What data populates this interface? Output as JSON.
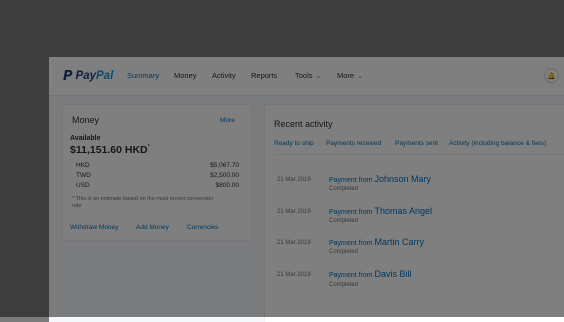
{
  "brand": {
    "logo_glyph": "P",
    "name_part1": "Pay",
    "name_part2": "Pal"
  },
  "nav": {
    "items": [
      {
        "label": "Summary",
        "active": true
      },
      {
        "label": "Money"
      },
      {
        "label": "Activity"
      },
      {
        "label": "Reports"
      },
      {
        "label": "Tools"
      },
      {
        "label": "More"
      }
    ],
    "chevron": "⌄",
    "bell_glyph": "🔔"
  },
  "money": {
    "title": "Money",
    "more_link": "More",
    "available_label": "Available",
    "available_amount": "$11,151.60 HKD",
    "asterisk": "*",
    "balances": [
      {
        "code": "HKD",
        "amount": "$5,067.70"
      },
      {
        "code": "TWD",
        "amount": "$2,500.00"
      },
      {
        "code": "USD",
        "amount": "$800.00"
      }
    ],
    "note": "* This is an estimate based on the most recent conversion rate",
    "actions": {
      "withdraw": "Withdraw Money",
      "add": "Add Money",
      "currencies": "Currencies"
    }
  },
  "recent": {
    "title": "Recent activity",
    "tabs": [
      "Ready to ship",
      "Payments received",
      "Payments sent",
      "Activity (including balance & fees)"
    ],
    "rows": [
      {
        "date": "21 Mar 2019",
        "prefix": "Payment from",
        "name": "Johnson Mary",
        "status": "Completed"
      },
      {
        "date": "21 Mar 2019",
        "prefix": "Payment from",
        "name": "Thomas Angel",
        "status": "Completed"
      },
      {
        "date": "21 Mar 2019",
        "prefix": "Payment from",
        "name": "Martin Carry",
        "status": "Completed"
      },
      {
        "date": "21 Mar 2019",
        "prefix": "Payment from",
        "name": "Davis Bill",
        "status": "Completed"
      }
    ]
  },
  "colors": {
    "brand_dark": "#253b80",
    "brand_light": "#179bd7",
    "link": "#0070ba",
    "overlay": "rgba(0,0,0,0.5)"
  }
}
